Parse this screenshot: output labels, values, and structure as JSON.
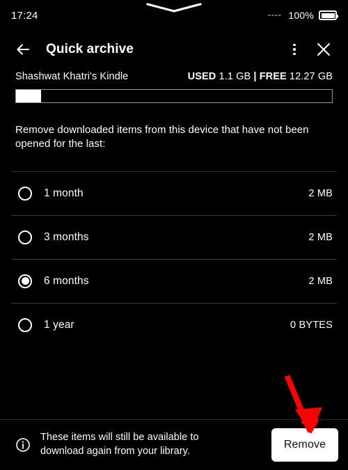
{
  "status_bar": {
    "time": "17:24",
    "signal_icon": "signal-dashes-icon",
    "battery_percent": "100%",
    "battery_icon": "battery-full-icon",
    "notch_icon": "notch-chevron-icon"
  },
  "app_bar": {
    "back_icon": "back-arrow-icon",
    "title": "Quick archive",
    "overflow_icon": "more-vertical-icon",
    "close_icon": "close-x-icon"
  },
  "storage": {
    "device_name": "Shashwat Khatri's Kindle",
    "used_label": "USED",
    "used_value": "1.1 GB",
    "separator": "|",
    "free_label": "FREE",
    "free_value": "12.27 GB",
    "used_percent": 8.0
  },
  "instructions": "Remove downloaded items from this device that have not been opened for the last:",
  "options": [
    {
      "label": "1 month",
      "size": "2 MB",
      "selected": false
    },
    {
      "label": "3 months",
      "size": "2 MB",
      "selected": false
    },
    {
      "label": "6 months",
      "size": "2 MB",
      "selected": true
    },
    {
      "label": "1 year",
      "size": "0 BYTES",
      "selected": false
    }
  ],
  "footer": {
    "info_icon": "info-circle-icon",
    "note_line1": "These items will still be available to",
    "note_line2": "download again from your library.",
    "remove_label": "Remove"
  },
  "annotation": {
    "arrow_icon": "red-arrow-icon",
    "arrow_color": "#FF0000"
  },
  "colors": {
    "background": "#000000",
    "foreground": "#FFFFFF",
    "divider": "#373737",
    "bar_border": "#9A9A9A",
    "accent_button_bg": "#FFFFFF",
    "accent_button_fg": "#111111"
  }
}
